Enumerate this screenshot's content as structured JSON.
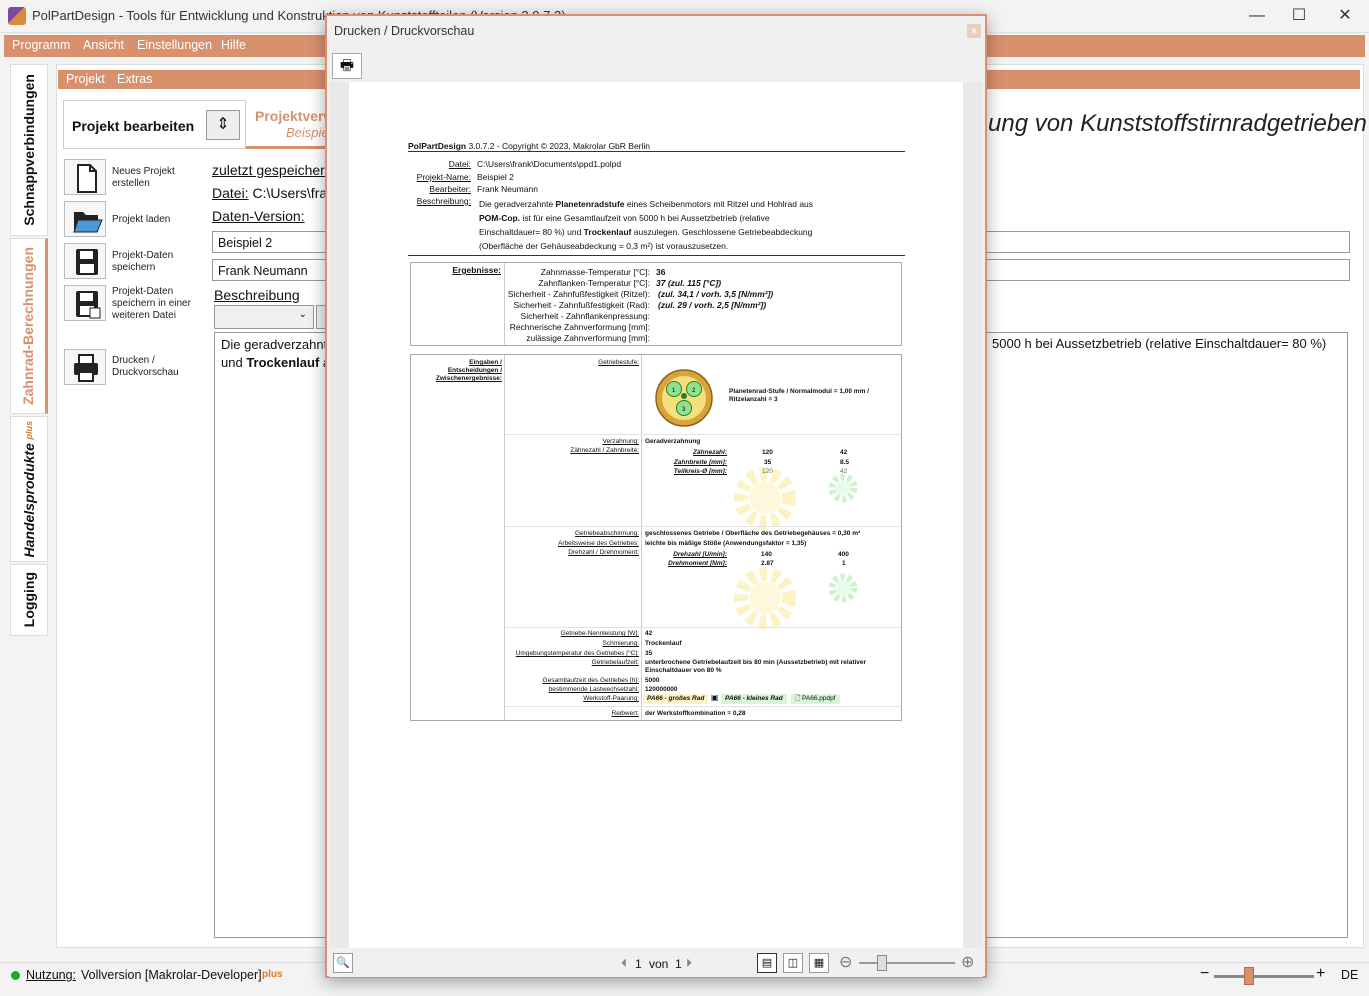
{
  "window": {
    "title": "PolPartDesign - Tools für Entwicklung und Konstruktion von Kunststoffteilen (Version 3.0.7.2)",
    "minimize": "—",
    "maximize": "☐",
    "close": "✕"
  },
  "menu": [
    "Programm",
    "Ansicht",
    "Einstellungen",
    "Hilfe"
  ],
  "sidetabs": {
    "schnapp": "Schnappverbindungen",
    "zahnrad": "Zahnrad-Berechnungen",
    "handel": "Handelsprodukte",
    "handel_plus": "plus",
    "logging": "Logging"
  },
  "submenu": [
    "Projekt",
    "Extras"
  ],
  "project": {
    "edit_label": "Projekt bearbeiten",
    "tab_title": "Projektverwaltung",
    "tab_sub": "Beispiel 2",
    "banner": "ung von Kunststoffstirnradgetrieben"
  },
  "actions": {
    "new": "Neues Projekt erstellen",
    "load": "Projekt laden",
    "save": "Projekt-Daten speichern",
    "save_as": "Projekt-Daten speichern in einer weiteren Datei",
    "print": "Drucken / Druckvorschau"
  },
  "fields": {
    "last_saved": "zuletzt gespeichert",
    "file_label": "Datei:",
    "file_value": "C:\\Users\\frank",
    "version_label": "Daten-Version:",
    "name_value": "Beispiel 2",
    "author_value": "Frank Neumann",
    "desc_label": "Beschreibung",
    "desc_line1": "Die geradverzahnt",
    "desc_line2_a": "und ",
    "desc_line2_b": "Trockenlauf",
    "desc_line2_c": " a",
    "desc_right": "5000 h bei Aussetzbetrieb (relative Einschaltdauer= 80 %)"
  },
  "status": {
    "nutzung_label": "Nutzung:",
    "nutzung_value": "Vollversion [Makrolar-Developer]",
    "plus": "plus",
    "lang": "DE"
  },
  "dialog": {
    "title": "Drucken / Druckvorschau",
    "close": "✕",
    "page_label": "1",
    "page_of": "von",
    "page_total": "1"
  },
  "doc": {
    "header_bold": "PolPartDesign",
    "header_rest": " 3.0.7.2 - Copyright © 2023, Makrolar GbR Berlin",
    "meta": [
      {
        "label": "Datei:",
        "value": "C:\\Users\\frank\\Documents\\ppd1.polpd"
      },
      {
        "label": "Projekt-Name:",
        "value": "Beispiel 2"
      },
      {
        "label": "Bearbeiter:",
        "value": "Frank Neumann"
      },
      {
        "label": "Beschreibung:",
        "value": ""
      }
    ],
    "desc": {
      "l1a": "Die geradverzahnte ",
      "l1b": "Planetenradstufe",
      "l1c": " eines Scheibenmotors mit Ritzel und Hohlrad aus",
      "l2a": "POM-Cop.",
      "l2b": " ist für eine Gesamtlaufzeit von 5000 h bei Aussetzbetrieb (relative",
      "l3a": "Einschaltdauer= 80 %) und ",
      "l3b": "Trockenlauf",
      "l3c": " auszulegen. Geschlossene Getriebeabdeckung",
      "l4": "(Oberfläche der Gehäuseabdeckung = 0,3 m²) ist vorauszusetzen."
    },
    "results_label": "Ergebnisse:",
    "results": [
      {
        "label": "Zahnmasse-Temperatur [°C]:",
        "value": "36"
      },
      {
        "label": "Zahnflanken-Temperatur [°C]:",
        "value": "37 (zul. 115 [°C])"
      },
      {
        "label": "Sicherheit - Zahnfußfestigkeit (Ritzel):",
        "value": "(zul. 34,1 / vorh. 3,5 [N/mm²])"
      },
      {
        "label": "Sicherheit - Zahnfußfestigkeit (Rad):",
        "value": "(zul. 29 / vorh. 2,5 [N/mm²])"
      },
      {
        "label": "Sicherheit - Zahnflankenpressung:",
        "value": ""
      },
      {
        "label": "Rechnerische Zahnverformung [mm]:",
        "value": ""
      },
      {
        "label": "zulässige Zahnverformung [mm]:",
        "value": ""
      }
    ],
    "inputs_label_1": "Eingaben /",
    "inputs_label_2": "Entscheidungen /",
    "inputs_label_3": "Zwischenergebnisse:",
    "getriebestufe_label": "Getriebestufe:",
    "getriebestufe_value_1": "Planetenrad-Stufe / Normalmodul = 1,00 mm /",
    "getriebestufe_value_2": "Ritzelanzahl = 3",
    "verzahnung_label": "Verzahnung:",
    "verzahnung_value": "Geradverzahnung",
    "zz_label": "Zähnezahl / Zahnbreite:",
    "zz_rows": [
      {
        "label": "Zähnezahl:",
        "v1": "120",
        "v2": "42"
      },
      {
        "label": "Zahnbreite [mm]:",
        "v1": "35",
        "v2": "8.5"
      },
      {
        "label": "Teilkreis-Ø [mm]:",
        "v1": "120",
        "v2": "42"
      }
    ],
    "abschirmung_label": "Getriebeabschirmung:",
    "abschirmung_value": "geschlossenes Getriebe / Oberfläche des Getriebegehäuses = 0,30 m²",
    "arbeitsweise_label": "Arbeitsweise des Getriebes:",
    "arbeitsweise_value": "leichte bis mäßige Stöße (Anwendungsfaktor = 1,35)",
    "drehzahl_label": "Drehzahl / Drehmoment:",
    "dz_rows": [
      {
        "label": "Drehzahl [U/min]:",
        "v1": "140",
        "v2": "400"
      },
      {
        "label": "Drehmoment [Nm]:",
        "v1": "2.87",
        "v2": "1"
      }
    ],
    "lower": [
      {
        "label": "Getriebe-Nennleistung [W]:",
        "value": "42"
      },
      {
        "label": "Schmierung:",
        "value": "Trockenlauf"
      },
      {
        "label": "Umgebungstemperatur des Getriebes [°C]:",
        "value": "35"
      },
      {
        "label": "Getriebelaufzeit:",
        "value": "unterbrochene Getriebelaufzeit bis 80 min (Aussetzbetrieb) mit relativer"
      },
      {
        "label": "",
        "value": "Einschaltdauer von 80 %"
      },
      {
        "label": "Gesamtlaufzeit des Getriebes [h]:",
        "value": "5000"
      },
      {
        "label": "bestimmende Lastwechselzahl:",
        "value": "120000000"
      }
    ],
    "werkstoff_label": "Werkstoff-Paarung:",
    "werkstoff_gross": "PA66 - großes Rad",
    "werkstoff_klein": "PA66 - kleines Rad",
    "werkstoff_file": "PA66.ppdpf",
    "reibwert_label": "Reibwert:",
    "reibwert_value": "der Werkstoffkombination = 0,28"
  }
}
